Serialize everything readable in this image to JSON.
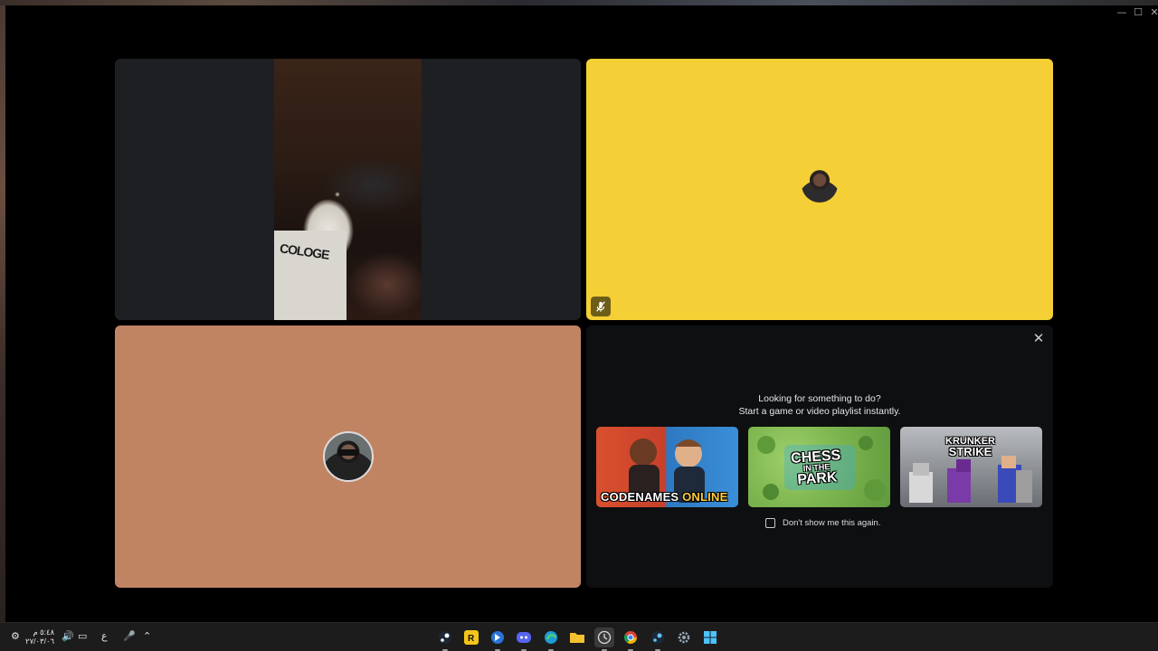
{
  "window": {
    "controls": {
      "minimize": "—",
      "maximize": "☐",
      "close": "✕"
    }
  },
  "tiles": [
    {
      "name": "camera-feed",
      "shirt_text": "COLOGE"
    },
    {
      "name": "voice-yellow",
      "color": "#f4cf35",
      "muted": true
    },
    {
      "name": "voice-orange",
      "color": "#c18463"
    }
  ],
  "activity_panel": {
    "close_label": "✕",
    "title_line1": "Looking for something to do?",
    "title_line2": "Start a game or video playlist instantly.",
    "games": [
      {
        "name": "codenames",
        "label_main": "CODENAMES",
        "label_accent": "ONLINE"
      },
      {
        "name": "chess",
        "label_line1": "CHESS",
        "label_line2": "IN THE",
        "label_line3": "PARK"
      },
      {
        "name": "krunker",
        "label_line1": "KRUNKER",
        "label_line2": "STRIKE"
      }
    ],
    "dont_show": "Don't show me this again."
  },
  "taskbar": {
    "clock_time": "٥:٤٨ م",
    "clock_date": "٢٧/٠٣/٠٦",
    "lang": "ع",
    "apps": [
      "steam-icon",
      "rockstar-icon",
      "app-icon",
      "discord-icon",
      "edge-icon",
      "file-explorer-icon",
      "clock-app-icon",
      "chrome-icon",
      "steam-icon",
      "settings-icon",
      "windows-start-icon"
    ]
  }
}
